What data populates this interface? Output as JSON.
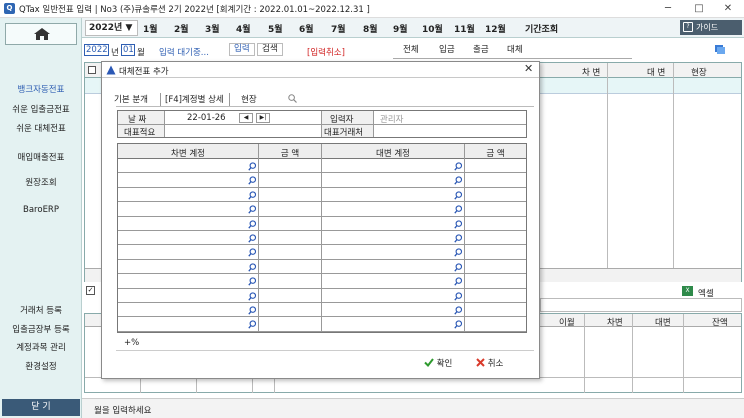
{
  "window": {
    "title": "QTax 일반전표 입력 | No3 (주)큐솔루션 2기 2022년 [회계기간 : 2022.01.01~2022.12.31 ]",
    "minimize": "─",
    "maximize": "□",
    "close": "✕"
  },
  "sidebar": {
    "items": [
      "뱅크자동전표",
      "쉬운 입출금전표",
      "쉬운 대체전표",
      "매입매출전표",
      "원장조회",
      "BaroERP",
      "거래처 등록",
      "입출금장부 등록",
      "계정과목 관리",
      "환경설정"
    ],
    "close_label": "닫 기"
  },
  "monthbar": {
    "year": "2022년",
    "months": [
      "1월",
      "2월",
      "3월",
      "4월",
      "5월",
      "6월",
      "7월",
      "8월",
      "9월",
      "10월",
      "11월",
      "12월",
      "기간조회"
    ],
    "guide": "가이드"
  },
  "toprow": {
    "year_value": "2022",
    "year_suffix": "년",
    "month_value": "01",
    "month_suffix": "월",
    "pending": "입력 대기중...",
    "tab_input": "입력",
    "tab_search": "검색",
    "cancel_input": "[입력취소]",
    "filters": [
      "전체",
      "입금",
      "출금",
      "대체"
    ]
  },
  "background": {
    "col_debit": "차 변",
    "col_credit": "대 변",
    "col_site": "현장",
    "excel": "엑셀",
    "lower_cols": [
      "이월",
      "차변",
      "대변",
      "잔액"
    ]
  },
  "status": {
    "text": "월을 입력하세요"
  },
  "dialog": {
    "title": "대체전표 추가",
    "close": "✕",
    "tabs": [
      "기본 분개",
      "[F4]계정별 상세",
      "현장"
    ],
    "date_label": "날    짜",
    "date_value": "22-01-26",
    "prev": "◀",
    "next": "▶|",
    "writer_label": "입력자",
    "writer_value": "관리자",
    "memo_label": "대표적요",
    "partner_label": "대표거래처",
    "grid_headers": [
      "차변 계정",
      "금    액",
      "대변 계정",
      "금    액"
    ],
    "row_count": 12,
    "percent": "+%",
    "ok": "확인",
    "cancel": "취소"
  },
  "colors": {
    "accent": "#2f5fb3",
    "red": "#d02020",
    "sidebar_bg": "#e4f2f2",
    "ok_green": "#2e9a2e",
    "cancel_red": "#d93a2b"
  }
}
